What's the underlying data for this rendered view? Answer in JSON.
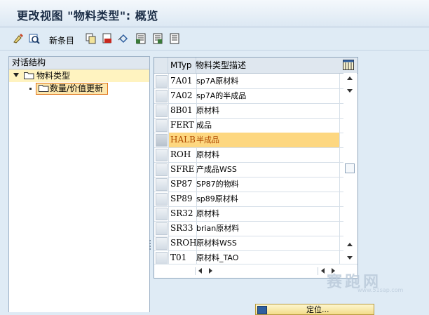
{
  "window": {
    "title": "更改视图 \"物料类型\": 概览"
  },
  "toolbar": {
    "new_entries_label": "新条目",
    "icons": [
      "display-change-icon",
      "other-view-icon",
      "copy-icon",
      "delete-icon",
      "undo-icon",
      "select-all-icon",
      "select-block-icon",
      "deselect-all-icon"
    ]
  },
  "dialog_structure": {
    "header": "对话结构",
    "nodes": [
      {
        "label": "物料类型",
        "expanded": true,
        "level": 0
      },
      {
        "label": "数量/价值更新",
        "level": 1,
        "selected": true
      }
    ]
  },
  "table": {
    "columns": [
      "MTyp",
      "物料类型描述"
    ],
    "rows": [
      {
        "mtyp": "7A01",
        "desc": "sp7A原材料"
      },
      {
        "mtyp": "7A02",
        "desc": "sp7A的半成品"
      },
      {
        "mtyp": "8B01",
        "desc": "原材料"
      },
      {
        "mtyp": "FERT",
        "desc": "成品"
      },
      {
        "mtyp": "HALB",
        "desc": "半成品",
        "highlighted": true
      },
      {
        "mtyp": "ROH",
        "desc": "原材料"
      },
      {
        "mtyp": "SFRE",
        "desc": "产成品WSS"
      },
      {
        "mtyp": "SP87",
        "desc": "SP87的物料"
      },
      {
        "mtyp": "SP89",
        "desc": "sp89原材料"
      },
      {
        "mtyp": "SR32",
        "desc": "原材料"
      },
      {
        "mtyp": "SR33",
        "desc": "brian原材料"
      },
      {
        "mtyp": "SROH",
        "desc": "原材料WSS"
      },
      {
        "mtyp": "T01",
        "desc": "原材料_TAO"
      }
    ]
  },
  "position_button": {
    "label": "定位..."
  },
  "watermark": {
    "text": "赛跑网",
    "sub": "www.51sap.com"
  },
  "colors": {
    "highlight_row": "#fdd780",
    "tree_selected": "#fff3c0",
    "background": "#dfebf5"
  }
}
